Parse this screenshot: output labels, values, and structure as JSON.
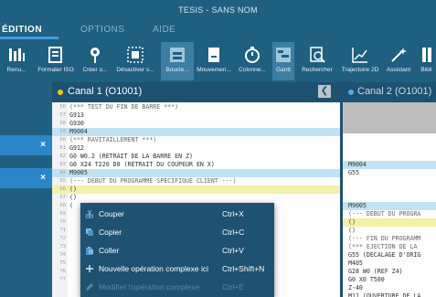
{
  "window": {
    "title": "TESIS - SANS NOM"
  },
  "menu": {
    "tabs": [
      {
        "label": "ÉDITION",
        "active": true
      },
      {
        "label": "OPTIONS",
        "active": false
      },
      {
        "label": "AIDE",
        "active": false
      }
    ]
  },
  "toolbar": {
    "buttons": [
      {
        "label": "Renu...",
        "icon": "renumber-icon"
      },
      {
        "label": "Formater ISO",
        "icon": "format-iso-icon"
      },
      {
        "label": "Créer o...",
        "icon": "create-origin-icon"
      },
      {
        "label": "Désactiver s...",
        "icon": "deactivate-icon"
      },
      {
        "label": "Boucle...",
        "icon": "loop-icon",
        "selected": true
      },
      {
        "label": "Mouvemen...",
        "icon": "movement-icon"
      },
      {
        "label": "Colonne...",
        "icon": "timer-icon"
      },
      {
        "label": "Gantt",
        "icon": "gantt-icon",
        "selected": true
      },
      {
        "label": "Rechercher",
        "icon": "search-icon"
      },
      {
        "label": "Trajectoire 2D",
        "icon": "trajectory-icon"
      },
      {
        "label": "Assistant",
        "icon": "wand-icon"
      },
      {
        "label": "Bibli",
        "icon": "library-icon"
      }
    ]
  },
  "left_panel": {
    "close_glyph": "×"
  },
  "editor1": {
    "title": "Canal 1 (O1001)",
    "collapse_glyph": "❮",
    "lines": [
      {
        "no": "56",
        "text": "(*** TEST DU FIN DE BARRE ***)",
        "style": "cmt"
      },
      {
        "no": "57",
        "text": "G913"
      },
      {
        "no": "58",
        "text": "G930"
      },
      {
        "no": "59",
        "text": "M9004",
        "hl": "blue"
      },
      {
        "no": "60",
        "text": "(*** RAVITAILLEMENT ***)",
        "style": "cmt"
      },
      {
        "no": "61",
        "text": "G912"
      },
      {
        "no": "62",
        "text": "G0 W0.2 (RETRAIT DE LA BARRE EN Z)"
      },
      {
        "no": "63",
        "text": "G0 X24 T220 D0 (RETRAIT DU COUPEUR EN X)"
      },
      {
        "no": "64",
        "text": "M9005",
        "hl": "blue"
      },
      {
        "no": "65",
        "text": "(--- DEBUT DU PROGRAMME SPECIFIQUE CLIENT ---)",
        "style": "cmt"
      },
      {
        "no": "66",
        "text": "()",
        "hl": "yellow"
      },
      {
        "no": "67",
        "text": "()"
      },
      {
        "no": "68",
        "text": "("
      },
      {
        "no": "69",
        "text": ""
      },
      {
        "no": "70",
        "text": ""
      },
      {
        "no": "71",
        "text": ""
      },
      {
        "no": "72",
        "text": ""
      },
      {
        "no": "73",
        "text": ""
      },
      {
        "no": "74",
        "text": ""
      },
      {
        "no": "75",
        "text": ""
      },
      {
        "no": "76",
        "text": ""
      },
      {
        "no": "77",
        "text": ""
      }
    ]
  },
  "editor2": {
    "title": "Canal 2 (O1001)",
    "lines": [
      {
        "text": "M9004",
        "hl": "blue",
        "row": 8
      },
      {
        "text": "G55",
        "row": 9
      },
      {
        "text": "M9005",
        "hl": "blue",
        "row": 13
      },
      {
        "text": "(--- DEBUT DU PROGRA",
        "style": "cmt",
        "row": 14
      },
      {
        "text": "()",
        "hl": "yellow",
        "row": 15
      },
      {
        "text": "()",
        "row": 16
      },
      {
        "text": "(--- FIN DU PROGRAMM",
        "style": "cmt",
        "row": 17
      },
      {
        "text": "(*** EJECTION DE LA",
        "style": "cmt",
        "row": 18
      },
      {
        "text": "G55 (DECALAGE D'ORIG",
        "row": 19
      },
      {
        "text": "M405",
        "row": 20
      },
      {
        "text": "G28 W0 (REF Z4)",
        "row": 21
      },
      {
        "text": "G0 X0 T500",
        "row": 22
      },
      {
        "text": "Z-40",
        "row": 23
      },
      {
        "text": "M11 (OUVERTURE DE LA",
        "row": 24
      }
    ]
  },
  "context_menu": {
    "items": [
      {
        "label": "Couper",
        "shortcut": "Ctrl+X",
        "icon": "cut-icon"
      },
      {
        "label": "Copier",
        "shortcut": "Ctrl+C",
        "icon": "copy-icon"
      },
      {
        "label": "Coller",
        "shortcut": "Ctrl+V",
        "icon": "paste-icon"
      },
      {
        "label": "Nouvelle opération complexe ici",
        "shortcut": "Ctrl+Shift+N",
        "icon": "plus-icon"
      },
      {
        "label": "Modifier l'opération complexe",
        "shortcut": "Ctrl+E",
        "icon": "pencil-icon",
        "disabled": true
      }
    ]
  },
  "colors": {
    "accent": "#3aa0e0",
    "titlebar": "#1f5f80",
    "highlight_blue": "#bfe3f5",
    "highlight_yellow": "#f4f0a8"
  }
}
